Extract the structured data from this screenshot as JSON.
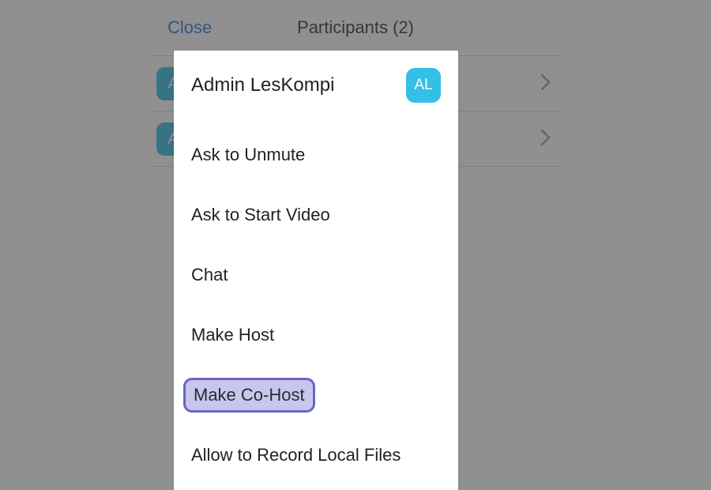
{
  "header": {
    "close_label": "Close",
    "title": "Participants (2)"
  },
  "participants": {
    "row1_avatar_initial": "A",
    "row2_avatar_initial": "A"
  },
  "sheet": {
    "participant_name": "Admin LesKompi",
    "avatar_initials": "AL",
    "actions": {
      "ask_unmute": "Ask to Unmute",
      "ask_start_video": "Ask to Start Video",
      "chat": "Chat",
      "make_host": "Make Host",
      "make_cohost": "Make Co-Host",
      "allow_record": "Allow to Record Local Files"
    }
  },
  "colors": {
    "accent_blue": "#1c78d6",
    "avatar_blue": "#34bfe7",
    "highlight_border": "#6b64c4",
    "highlight_fill": "#c8c6ed"
  }
}
